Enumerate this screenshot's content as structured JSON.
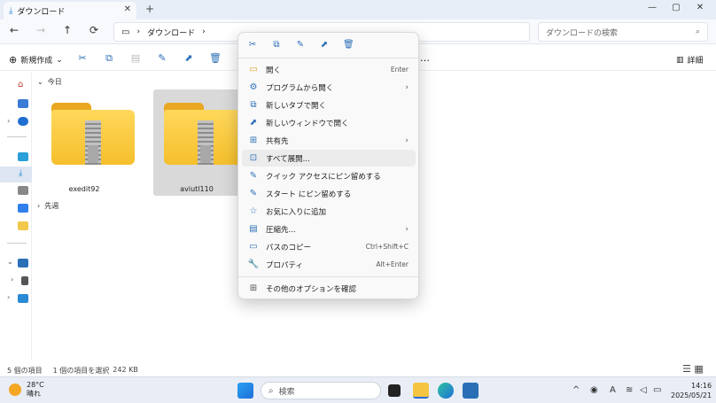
{
  "window": {
    "tab_title": "ダウンロード",
    "new_tab": "+",
    "minimize": "—",
    "maximize": "▢",
    "close": "✕"
  },
  "nav": {
    "back": "←",
    "forward": "→",
    "up": "↑",
    "refresh": "⟳",
    "breadcrumb": "ダウンロード",
    "breadcrumb_sep": "›",
    "search_placeholder": "ダウンロードの検索",
    "search_icon": "search-icon"
  },
  "toolbar": {
    "new_label": "新規作成",
    "new_chevron": "⌄",
    "more": "…",
    "details_label": "詳細"
  },
  "content": {
    "group_today": "今日",
    "group_lastweek": "先週",
    "files": [
      {
        "name": "exedit92",
        "selected": false
      },
      {
        "name": "aviutl110",
        "selected": true
      }
    ]
  },
  "status": {
    "count": "5 個の項目",
    "selected": "1 個の項目を選択",
    "size": "242 KB"
  },
  "context_menu": {
    "top_icons": [
      "cut-icon",
      "copy-icon",
      "rename-icon",
      "share-icon",
      "delete-icon"
    ],
    "items": [
      {
        "label": "開く",
        "shortcut": "Enter",
        "icon": "open-icon",
        "glyph": "▭",
        "arrow": ""
      },
      {
        "label": "プログラムから開く",
        "shortcut": "",
        "icon": "open-with-icon",
        "glyph": "⚙",
        "arrow": "›"
      },
      {
        "label": "新しいタブで開く",
        "shortcut": "",
        "icon": "new-tab-icon",
        "glyph": "⧉",
        "arrow": ""
      },
      {
        "label": "新しいウィンドウで開く",
        "shortcut": "",
        "icon": "new-window-icon",
        "glyph": "⬈",
        "arrow": ""
      },
      {
        "label": "共有先",
        "shortcut": "",
        "icon": "share-to-icon",
        "glyph": "⊞",
        "arrow": "›"
      },
      {
        "label": "すべて展開...",
        "shortcut": "",
        "icon": "extract-all-icon",
        "glyph": "⊡",
        "arrow": ""
      },
      {
        "label": "クイック アクセスにピン留めする",
        "shortcut": "",
        "icon": "pin-quick-icon",
        "glyph": "✎",
        "arrow": ""
      },
      {
        "label": "スタート にピン留めする",
        "shortcut": "",
        "icon": "pin-start-icon",
        "glyph": "✎",
        "arrow": ""
      },
      {
        "label": "お気に入りに追加",
        "shortcut": "",
        "icon": "star-icon",
        "glyph": "☆",
        "arrow": ""
      },
      {
        "label": "圧縮先...",
        "shortcut": "",
        "icon": "compress-icon",
        "glyph": "▤",
        "arrow": "›"
      },
      {
        "label": "パスのコピー",
        "shortcut": "Ctrl+Shift+C",
        "icon": "copy-path-icon",
        "glyph": "▭",
        "arrow": ""
      },
      {
        "label": "プロパティ",
        "shortcut": "Alt+Enter",
        "icon": "properties-icon",
        "glyph": "🔧",
        "arrow": ""
      },
      {
        "label": "その他のオプションを確認",
        "shortcut": "",
        "icon": "more-options-icon",
        "glyph": "⊞",
        "arrow": ""
      }
    ]
  },
  "taskbar": {
    "temperature": "28°C",
    "weather": "晴れ",
    "search_label": "検索",
    "time": "14:16",
    "date": "2025/05/21",
    "ime": "A"
  }
}
